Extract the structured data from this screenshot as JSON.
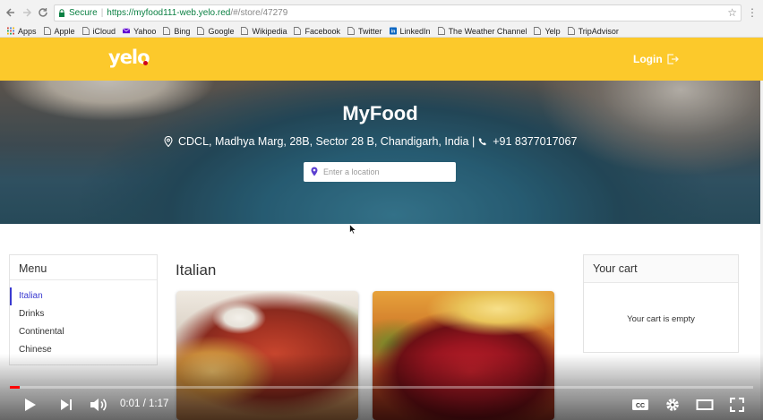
{
  "browser": {
    "secure_label": "Secure",
    "url_host": "https://myfood111-web.yelo.red",
    "url_path": "/#/store/47279",
    "bookmarks": [
      {
        "label": "Apps",
        "icon": "apps-grid-icon"
      },
      {
        "label": "Apple",
        "icon": "page-icon"
      },
      {
        "label": "iCloud",
        "icon": "page-icon"
      },
      {
        "label": "Yahoo",
        "icon": "yahoo-mail-icon"
      },
      {
        "label": "Bing",
        "icon": "page-icon"
      },
      {
        "label": "Google",
        "icon": "page-icon"
      },
      {
        "label": "Wikipedia",
        "icon": "page-icon"
      },
      {
        "label": "Facebook",
        "icon": "page-icon"
      },
      {
        "label": "Twitter",
        "icon": "page-icon"
      },
      {
        "label": "LinkedIn",
        "icon": "linkedin-icon"
      },
      {
        "label": "The Weather Channel",
        "icon": "page-icon"
      },
      {
        "label": "Yelp",
        "icon": "page-icon"
      },
      {
        "label": "TripAdvisor",
        "icon": "page-icon"
      }
    ]
  },
  "header": {
    "logo_text": "yelo",
    "login_label": "Login",
    "brand_color": "#fcc92b",
    "logo_dot_color": "#d0021b"
  },
  "hero": {
    "store_name": "MyFood",
    "address": "CDCL, Madhya Marg, 28B, Sector 28 B, Chandigarh, India |",
    "phone": "+91 8377017067",
    "location_placeholder": "Enter a location"
  },
  "menu": {
    "title": "Menu",
    "accent_color": "#3a3ad0",
    "items": [
      {
        "label": "Italian",
        "active": true
      },
      {
        "label": "Drinks",
        "active": false
      },
      {
        "label": "Continental",
        "active": false
      },
      {
        "label": "Chinese",
        "active": false
      }
    ]
  },
  "catalog": {
    "section_title": "Italian",
    "dishes": [
      {
        "image": "pasta-dish-photo"
      },
      {
        "image": "tandoori-chicken-photo"
      }
    ]
  },
  "cart": {
    "title": "Your cart",
    "empty_text": "Your cart is empty"
  },
  "player": {
    "current_time": "0:01",
    "duration": "1:17",
    "progress_fraction": 0.013,
    "progress_color": "#ff0000"
  }
}
